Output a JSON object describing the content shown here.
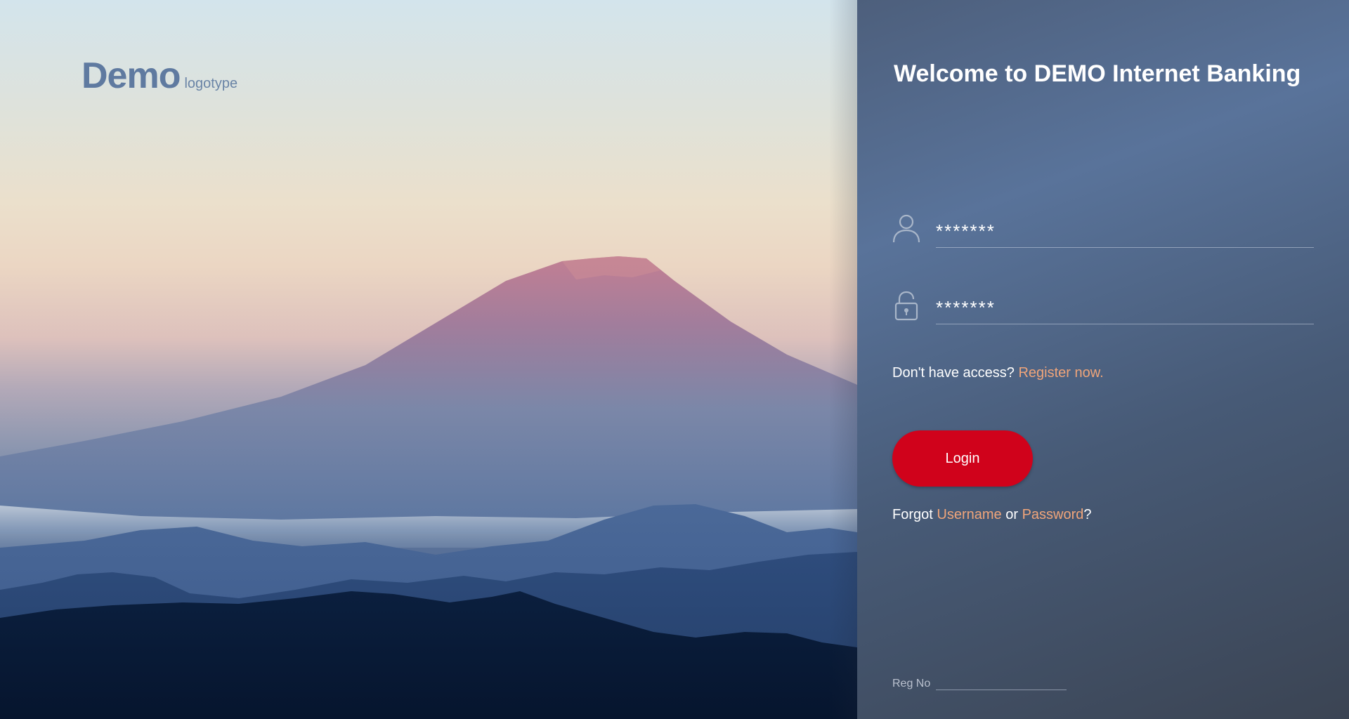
{
  "logo": {
    "main": "Demo",
    "sub": "logotype"
  },
  "login_panel": {
    "title": "Welcome to DEMO Internet Banking",
    "username_value": "*******",
    "password_value": "*******",
    "access_text": "Don't have access?",
    "register_link": "Register now.",
    "login_button": "Login",
    "forgot_prefix": "Forgot",
    "username_link": "Username",
    "or_text": "or",
    "password_link": "Password",
    "forgot_suffix": "?",
    "reg_no_label": "Reg No",
    "reg_no_value": ""
  },
  "icons": {
    "username": "user-icon",
    "password": "lock-icon"
  },
  "colors": {
    "accent_link": "#f0a57a",
    "login_button": "#d0021b",
    "logo": "#5f7aa0"
  }
}
